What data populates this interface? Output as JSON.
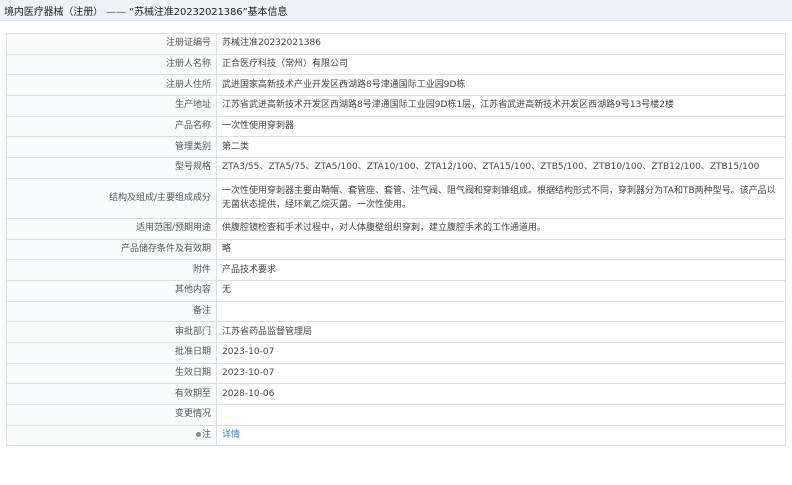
{
  "header": {
    "title_prefix": "境内医疗器械（注册）",
    "separator": "——",
    "title_main": "“苏械注准20232021386”基本信息"
  },
  "rows": [
    {
      "label": "注册证编号",
      "value": "苏械注准20232021386"
    },
    {
      "label": "注册人名称",
      "value": "正合医疗科技（常州）有限公司"
    },
    {
      "label": "注册人住所",
      "value": "武进国家高新技术产业开发区西湖路8号津通国际工业园9D栋"
    },
    {
      "label": "生产地址",
      "value": "江苏省武进高新技术开发区西湖路8号津通国际工业园9D栋1层，江苏省武进高新技术开发区西湖路9号13号楼2楼"
    },
    {
      "label": "产品名称",
      "value": "一次性使用穿刺器"
    },
    {
      "label": "管理类别",
      "value": "第二类"
    },
    {
      "label": "型号规格",
      "value": "ZTA3/55、ZTA5/75、ZTA5/100、ZTA10/100、ZTA12/100、ZTA15/100、ZTB5/100、ZTB10/100、ZTB12/100、ZTB15/100"
    },
    {
      "label": "结构及组成/主要组成成分",
      "value": "一次性使用穿刺器主要由鞘帽、套管座、套管、注气阀、阻气阀和穿刺锥组成。根据结构形式不同，穿刺器分为TA和TB两种型号。该产品以无菌状态提供，经环氧乙烷灭菌。一次性使用。"
    },
    {
      "label": "适用范围/预期用途",
      "value": "供腹腔镜检查和手术过程中，对人体腹壁组织穿刺，建立腹腔手术的工作通道用。"
    },
    {
      "label": "产品储存条件及有效期",
      "value": "略"
    },
    {
      "label": "附件",
      "value": "产品技术要求"
    },
    {
      "label": "其他内容",
      "value": "无"
    },
    {
      "label": "备注",
      "value": ""
    },
    {
      "label": "审批部门",
      "value": "江苏省药品监督管理局"
    },
    {
      "label": "批准日期",
      "value": "2023-10-07"
    },
    {
      "label": "生效日期",
      "value": "2023-10-07"
    },
    {
      "label": "有效期至",
      "value": "2028-10-06"
    },
    {
      "label": "变更情况",
      "value": ""
    }
  ],
  "note_row": {
    "label": "注",
    "link_text": "详情"
  }
}
